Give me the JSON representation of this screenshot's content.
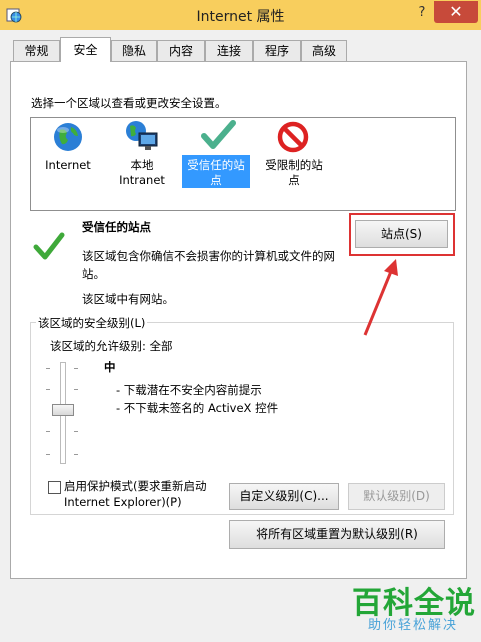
{
  "window": {
    "title": "Internet 属性",
    "help": "?",
    "close": "✕"
  },
  "tabs": [
    "常规",
    "安全",
    "隐私",
    "内容",
    "连接",
    "程序",
    "高级"
  ],
  "instructions": "选择一个区域以查看或更改安全设置。",
  "zones": [
    {
      "line1": "Internet",
      "line2": "",
      "icon": "globe-icon"
    },
    {
      "line1": "本地",
      "line2": "Intranet",
      "icon": "local-intranet-icon"
    },
    {
      "line1": "受信任的站",
      "line2": "点",
      "icon": "checkmark-icon",
      "selected": true
    },
    {
      "line1": "受限制的站",
      "line2": "点",
      "icon": "no-entry-icon"
    }
  ],
  "zone_info": {
    "title": "受信任的站点",
    "desc_line1": "该区域包含你确信不会损害你的计算机或文件的网",
    "desc_line2": "站。",
    "has_sites": "该区域中有网站。",
    "sites_button": "站点(S)"
  },
  "security_level": {
    "group_label": "该区域的安全级别(L)",
    "allowed": "该区域的允许级别: 全部",
    "level_name": "中",
    "bullet1": "- 下载潜在不安全内容前提示",
    "bullet2": "- 不下载未签名的 ActiveX 控件",
    "level_fraction": 0.5
  },
  "protected_mode": {
    "line1": "启用保护模式(要求重新启动",
    "line2": "Internet Explorer)(P)",
    "checked": false
  },
  "buttons": {
    "custom_level": "自定义级别(C)...",
    "default_level": "默认级别(D)",
    "reset_all": "将所有区域重置为默认级别(R)"
  },
  "watermark": {
    "main": "百科全说",
    "sub": "助你轻松解决"
  },
  "colors": {
    "title_bar": "#f8ce5d",
    "selection": "#3399ff",
    "highlight": "#d33333",
    "watermark": "#23a637"
  }
}
